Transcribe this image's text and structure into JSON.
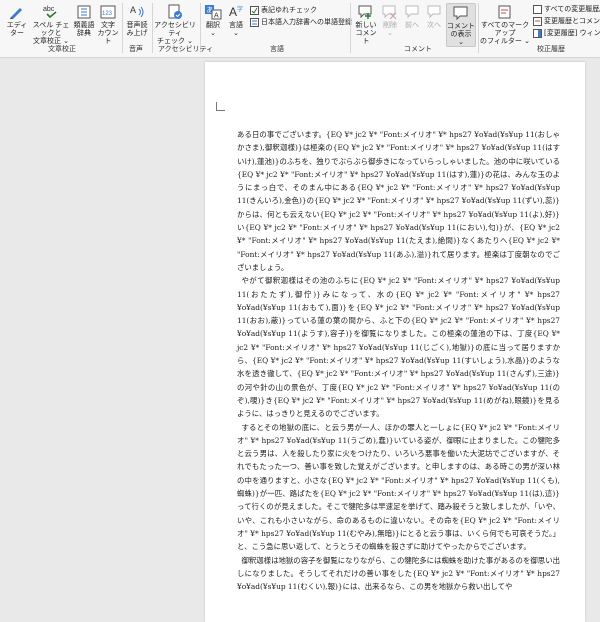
{
  "ribbon": {
    "buttons": [
      {
        "label": "エディ\nター"
      },
      {
        "label": "スペル チェックと\n文章校正 ⌄"
      },
      {
        "label": "類義語\n辞典"
      },
      {
        "label": "文字\nカウント"
      },
      {
        "label": "音声読\nみ上げ"
      },
      {
        "label": "アクセシビリティ\nチェック ⌄"
      },
      {
        "label": "翻訳\n⌄"
      },
      {
        "label": "言語\n⌄"
      },
      {
        "label": "新しい\nコメント"
      },
      {
        "label": "削除\n⌄"
      },
      {
        "label": "前へ"
      },
      {
        "label": "次へ"
      },
      {
        "label": "コメント\nの表示 ⌄"
      },
      {
        "label": "すべてのマークアップ\nのフィルター ⌄"
      }
    ],
    "small_items": [
      {
        "label": "表記ゆれチェック"
      },
      {
        "label": "日本語入力辞書への単語登録"
      },
      {
        "label": "すべての変更履歴/コメ"
      },
      {
        "label": "変更履歴とコメントの表"
      },
      {
        "label": "[変更履歴] ウィンドウ ⌄"
      }
    ],
    "groups": [
      {
        "label": "文章校正"
      },
      {
        "label": "音声"
      },
      {
        "label": "アクセシビリティ"
      },
      {
        "label": "言語"
      },
      {
        "label": "コメント"
      },
      {
        "label": "校正履歴"
      }
    ]
  },
  "document": {
    "paragraphs": [
      "ある日の事でございます。{EQ ¥* jc2 ¥* \"Font:メイリオ\" ¥* hps27 ¥o¥ad(¥s¥up 11(おしゃかさま),御釈迦様)}は極楽の{EQ ¥* jc2 ¥* \"Font:メイリオ\" ¥* hps27 ¥o¥ad(¥s¥up 11(はすいけ),蓮池)}のふちを、独りでぶらぶら御歩きになっていらっしゃいました。池の中に咲いている{EQ ¥* jc2 ¥* \"Font:メイリオ\" ¥* hps27 ¥o¥ad(¥s¥up 11(はす),蓮)}の花は、みんな玉のようにまっ白で、そのまん中にある{EQ ¥* jc2 ¥* \"Font:メイリオ\" ¥* hps27 ¥o¥ad(¥s¥up 11(きんいろ),金色)}の{EQ ¥* jc2 ¥* \"Font:メイリオ\" ¥* hps27 ¥o¥ad(¥s¥up 11(ずい),蕊)}からは、何とも云えない{EQ ¥* jc2 ¥* \"Font:メイリオ\" ¥* hps27 ¥o¥ad(¥s¥up 11(よ),好)}い{EQ ¥* jc2 ¥* \"Font:メイリオ\" ¥* hps27 ¥o¥ad(¥s¥up 11(におい),匂)}が、{EQ ¥* jc2 ¥* \"Font:メイリオ\" ¥* hps27 ¥o¥ad(¥s¥up 11(たえま),絶間)}なくあたりへ{EQ ¥* jc2 ¥* \"Font:メイリオ\" ¥* hps27 ¥o¥ad(¥s¥up 11(あふ),溢)}れて居ります。極楽は丁度朝なのでございましょう。",
      "やがて御釈迦様はその池のふちに{EQ ¥* jc2 ¥* \"Font:メイリオ\" ¥* hps27 ¥o¥ad(¥s¥up 11(おたたず),御佇)}みになって、水の{EQ ¥* jc2 ¥* \"Font:メイリオ\" ¥* hps27 ¥o¥ad(¥s¥up 11(おもて),面)}を{EQ ¥* jc2 ¥* \"Font:メイリオ\" ¥* hps27 ¥o¥ad(¥s¥up 11(おお),蔽)}っている蓮の葉の間から、ふと下の{EQ ¥* jc2 ¥* \"Font:メイリオ\" ¥* hps27 ¥o¥ad(¥s¥up 11(ようす),容子)}を御覧になりました。この極楽の蓮池の下は、丁度{EQ ¥* jc2 ¥* \"Font:メイリオ\" ¥* hps27 ¥o¥ad(¥s¥up 11(じごく),地獄)}の底に当って居りますから、{EQ ¥* jc2 ¥* \"Font:メイリオ\" ¥* hps27 ¥o¥ad(¥s¥up 11(すいしょう),水晶)}のような水を透き徹して、{EQ ¥* jc2 ¥* \"Font:メイリオ\" ¥* hps27 ¥o¥ad(¥s¥up 11(さんず),三途)}の河や針の山の景色が、丁度{EQ ¥* jc2 ¥* \"Font:メイリオ\" ¥* hps27 ¥o¥ad(¥s¥up 11(のぞ),覗)}き{EQ ¥* jc2 ¥* \"Font:メイリオ\" ¥* hps27 ¥o¥ad(¥s¥up 11(めがね),眼鏡)}を見るように、はっきりと見えるのでございます。",
      "するとその地獄の底に、と云う男が一人、ほかの罪人と一しょに{EQ ¥* jc2 ¥* \"Font:メイリオ\" ¥* hps27 ¥o¥ad(¥s¥up 11(うごめ),蠢)}いている姿が、御眼に止まりました。この犍陀多と云う男は、人を殺したり家に火をつけたり、いろいろ悪事を働いた大泥坊でございますが、それでもたった一つ、善い事を致した覚えがございます。と申しますのは、ある時この男が深い林の中を通りますと、小さな{EQ ¥* jc2 ¥* \"Font:メイリオ\" ¥* hps27 ¥o¥ad(¥s¥up 11(くも),蜘蛛)}が一匹、路ばたを{EQ ¥* jc2 ¥* \"Font:メイリオ\" ¥* hps27 ¥o¥ad(¥s¥up 11(は),這)}って行くのが見えました。そこで犍陀多は早速足を挙げて、踏み殺そうと致しましたが、「いや、いや、これも小さいながら、命のあるものに違いない。その命を{EQ ¥* jc2 ¥* \"Font:メイリオ\" ¥* hps27 ¥o¥ad(¥s¥up 11(むやみ),無暗)}にとると云う事は、いくら何でも可哀そうだ。」と、こう急に思い返して、とうとうその蜘蛛を殺さずに助けてやったからでございます。",
      "御釈迦様は地獄の容子を御覧になりながら、この犍陀多には蜘蛛を助けた事があるのを御思い出しになりました。そうしてそれだけの善い事をした{EQ ¥* jc2 ¥* \"Font:メイリオ\" ¥* hps27 ¥o¥ad(¥s¥up 11(むくい),報)}には、出来るなら、この男を地獄から救い出してや"
    ]
  }
}
